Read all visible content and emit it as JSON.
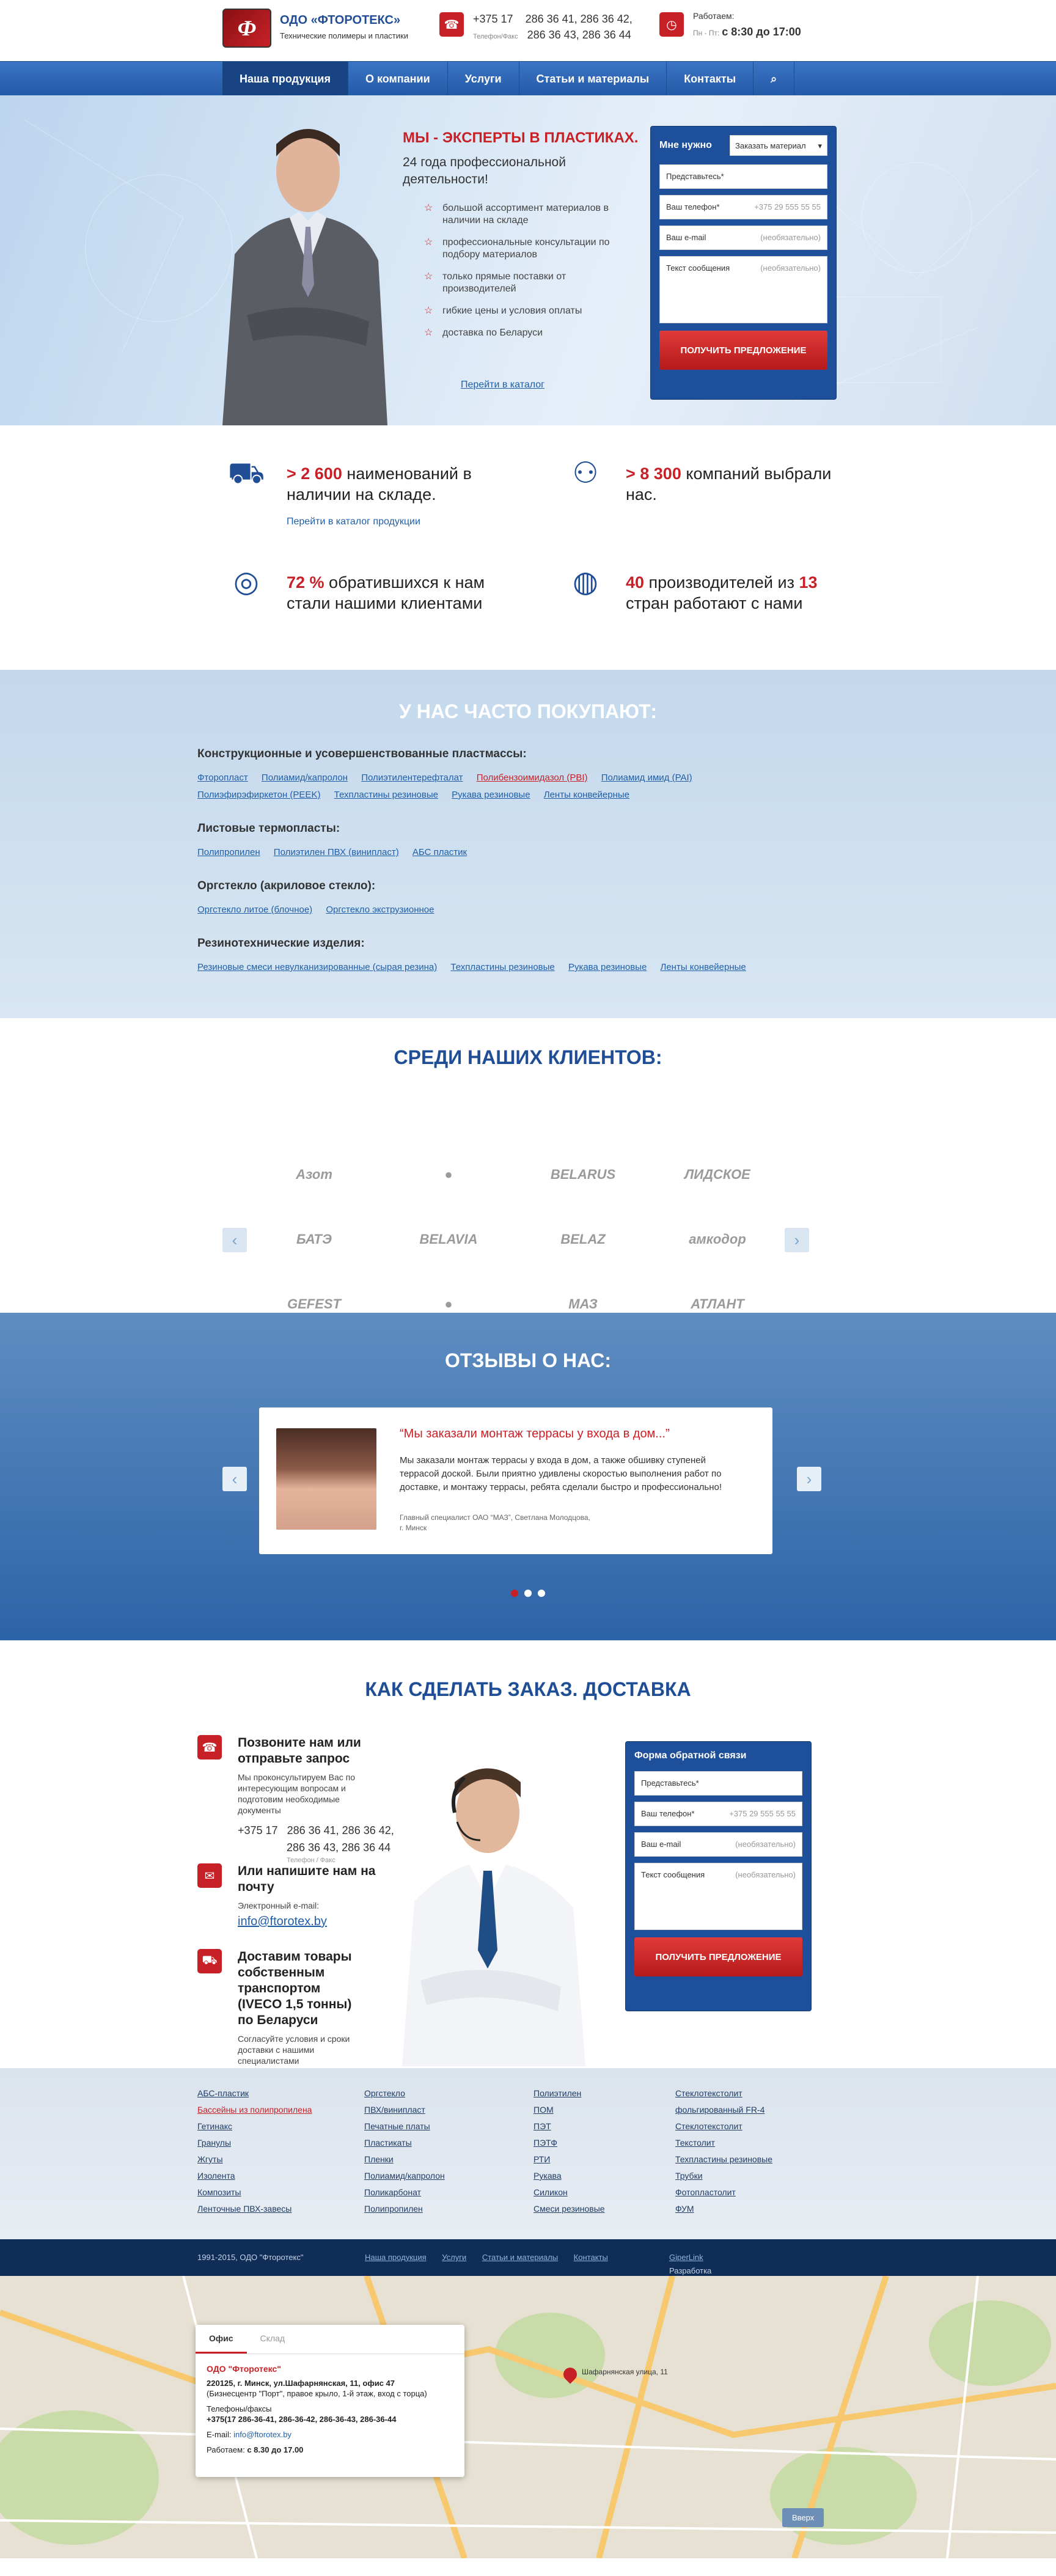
{
  "header": {
    "logo_letter": "Ф",
    "brand_name": "ОДО «ФТОРОТЕКС»",
    "brand_sub": "Технические полимеры и пластики",
    "phone_code": "+375 17",
    "phone_line1": "286 36 41, 286 36 42,",
    "phone_line2": "286 36 43, 286 36 44",
    "phone_note": "Телефон/Факс",
    "work_label": "Работаем:",
    "work_days": "Пн - Пт:",
    "work_hours": "с 8:30 до 17:00"
  },
  "nav": {
    "items": [
      "Наша продукция",
      "О компании",
      "Услуги",
      "Статьи и материалы",
      "Контакты"
    ]
  },
  "hero": {
    "title": "МЫ - ЭКСПЕРТЫ В ПЛАСТИКАХ.",
    "subtitle": "24 года профессиональной деятельности!",
    "list": [
      "большой ассортимент материалов в наличии на складе",
      "профессиональные консультации по подбору материалов",
      "только прямые поставки от производителей",
      "гибкие цены и условия оплаты",
      "доставка по Беларуси"
    ],
    "catalog_link": "Перейти в каталог"
  },
  "form1": {
    "need_label": "Мне нужно",
    "select_value": "Заказать материал",
    "name_ph": "Представьтесь*",
    "phone_label": "Ваш телефон*",
    "phone_ph": "+375 29 555 55 55",
    "email_label": "Ваш e-mail",
    "optional": "(необязательно)",
    "msg_label": "Текст сообщения",
    "button": "ПОЛУЧИТЬ ПРЕДЛОЖЕНИЕ"
  },
  "stats": {
    "s1_num": "> 2 600",
    "s1_text": " наименований в наличии на складе.",
    "s1_link": "Перейти в каталог продукции",
    "s2_num": "> 8 300",
    "s2_text": " компаний выбрали нас.",
    "s3_num": "72 %",
    "s3_text": " обратившихся к нам стали нашими клиентами",
    "s4_num1": "40",
    "s4_mid": " производителей из ",
    "s4_num2": "13",
    "s4_text": " стран работают с нами"
  },
  "popular": {
    "title": "У НАС ЧАСТО ПОКУПАЮТ:",
    "groups": [
      {
        "h": "Конструкционные и усовершенствованные пластмассы:",
        "links": [
          "Фторопласт",
          "Полиамид/капролон",
          "Полиэтилентерефталат",
          "Полибензоимидазол (PBI)",
          "Полиамид имид (PAI)",
          "Полиэфирэфиркетон (PEEK)",
          "Техпластины резиновые",
          "Рукава резиновые",
          "Ленты конвейерные"
        ]
      },
      {
        "h": "Листовые термопласты:",
        "links": [
          "Полипропилен",
          "Полиэтилен ПВХ (винипласт)",
          "АБС пластик"
        ]
      },
      {
        "h": "Оргстекло (акриловое стекло):",
        "links": [
          "Оргстекло литое (блочное)",
          "Оргстекло экструзионное"
        ]
      },
      {
        "h": "Резинотехнические изделия:",
        "links": [
          "Резиновые смеси невулканизированные (сырая резина)",
          "Техпластины резиновые",
          "Рукава резиновые",
          "Ленты конвейерные"
        ]
      }
    ]
  },
  "clients": {
    "title": "СРЕДИ НАШИХ КЛИЕНТОВ:",
    "logos": [
      "Азот",
      "●",
      "BELARUS",
      "ЛИДСКОЕ",
      "БАТЭ",
      "BELAVIA",
      "BELAZ",
      "амкодор",
      "GEFEST",
      "●",
      "МАЗ",
      "АТЛАНТ"
    ]
  },
  "reviews": {
    "title": "ОТЗЫВЫ О НАС:",
    "quote_title": "“Мы заказали монтаж террасы у входа в дом...”",
    "quote_text": "Мы заказали монтаж террасы у входа в дом, а также обшивку ступеней террасой доской. Были приятно удивлены скоростью выполнения работ по доставке, и монтажу террасы, ребята сделали быстро и профессионально!",
    "author": "Главный специалист ОАО “МАЗ”, Светлана Молодцова,",
    "city": "г. Минск"
  },
  "order": {
    "title": "КАК СДЕЛАТЬ ЗАКАЗ. ДОСТАВКА",
    "s1_title": "Позвоните нам или отправьте запрос",
    "s1_text": "Мы проконсультируем Вас по интересующим вопросам и подготовим необходимые документы",
    "s1_code": "+375 17",
    "s1_phone1": "286 36 41, 286 36 42,",
    "s1_phone2": "286 36 43, 286 36 44",
    "s1_note": "Телефон / Факс",
    "s2_title": "Или напишите нам на почту",
    "s2_label": "Электронный e-mail:",
    "s2_email": "info@ftorotex.by",
    "s3_title": "Доставим товары собственным транспортом (IVECO 1,5 тонны) по Беларуси",
    "s3_text": "Согласуйте условия и сроки доставки с нашими специалистами"
  },
  "form2": {
    "title": "Форма обратной связи",
    "name_ph": "Представьтесь*",
    "phone_label": "Ваш телефон*",
    "phone_ph": "+375 29 555 55 55",
    "email_label": "Ваш e-mail",
    "optional": "(необязательно)",
    "msg_label": "Текст сообщения",
    "button": "ПОЛУЧИТЬ ПРЕДЛОЖЕНИЕ"
  },
  "footer_links": {
    "col1": [
      "АБС-пластик",
      "Бассейны из полипропилена",
      "Гетинакс",
      "Гранулы",
      "Жгуты",
      "Изолента",
      "Композиты",
      "Ленточные ПВХ-завесы"
    ],
    "col2": [
      "Оргстекло",
      "ПВХ/винипласт",
      "Печатные платы",
      "Пластикаты",
      "Пленки",
      "Полиамид/капролон",
      "Поликарбонат",
      "Полипропилен"
    ],
    "col3": [
      "Полиэтилен",
      "ПОМ",
      "ПЭТ",
      "ПЭТФ",
      "РТИ",
      "Рукава",
      "Силикон",
      "Смеси резиновые"
    ],
    "col4": [
      "Стеклотекстолит",
      "фольгированный FR-4",
      "Стеклотекстолит",
      "Текстолит",
      "Техпластины резиновые",
      "Трубки",
      "Фотопластолит",
      "ФУМ"
    ]
  },
  "bottom_bar": {
    "copyright": "1991-2015, ОДО \"Фторотекс\"",
    "links": [
      "Наша продукция",
      "Услуги",
      "Статьи и материалы",
      "Контакты"
    ],
    "dev_label": "Разработка сайта -",
    "dev_name": "GiperLink"
  },
  "map": {
    "tab_office": "Офис",
    "tab_warehouse": "Склад",
    "company": "ОДО \"Фторотекс\"",
    "address": "220125, г. Минск, ул.Шафарнянская, 11, офис 47",
    "address_note": "(Бизнесцентр \"Порт\", правое крыло, 1-й этаж, вход с торца)",
    "phones_label": "Телефоны/факсы",
    "phones": "+375(17 286-36-41, 286-36-42, 286-36-43, 286-36-44",
    "email_label": "E-mail:",
    "email": "info@ftorotex.by",
    "work_label": "Работаем:",
    "work": "с 8.30 до 17.00",
    "pin_label": "Шафарнянская улица, 11",
    "map_btn": "Вверх"
  },
  "colors": {
    "brand_blue": "#1f4e96",
    "accent_red": "#c72127",
    "nav": "#2d66b5",
    "footer": "#102d58"
  }
}
